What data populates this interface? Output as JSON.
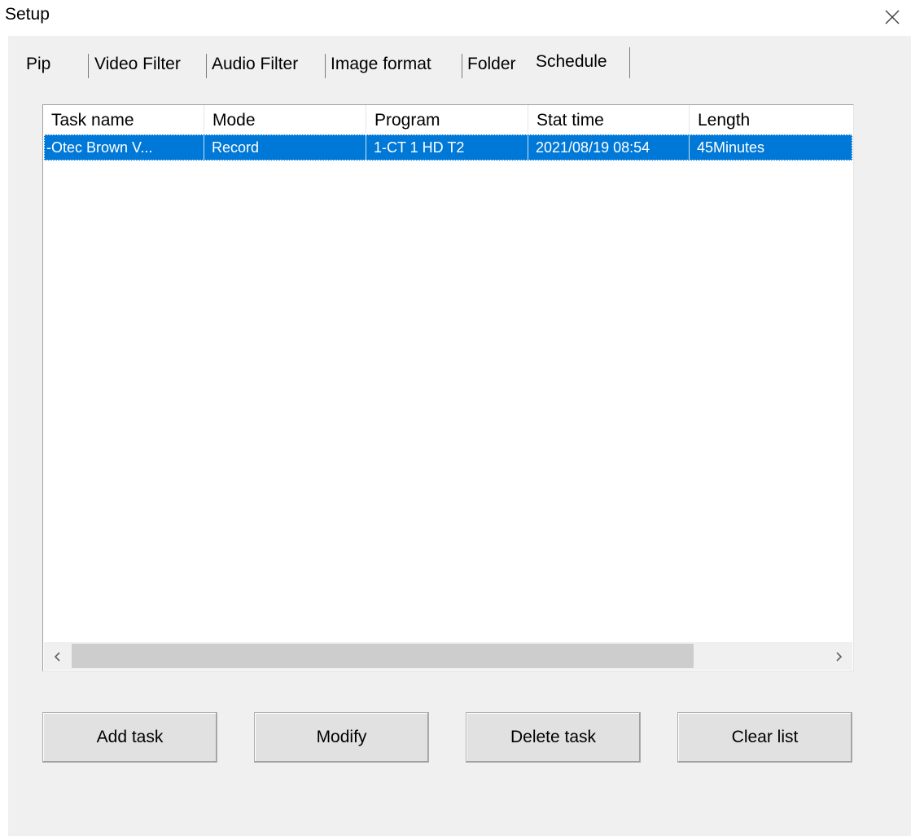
{
  "window": {
    "title": "Setup",
    "close_icon": "close-icon"
  },
  "tabs": [
    {
      "label": "Pip",
      "active": false
    },
    {
      "label": "Video Filter",
      "active": false
    },
    {
      "label": "Audio Filter",
      "active": false
    },
    {
      "label": "Image format",
      "active": false
    },
    {
      "label": "Folder",
      "active": false
    },
    {
      "label": "Schedule",
      "active": true
    }
  ],
  "schedule": {
    "columns": [
      "Task name",
      "Mode",
      "Program",
      "Stat time",
      "Length"
    ],
    "rows": [
      {
        "task_name": "-Otec Brown V...",
        "mode": "Record",
        "program": "1-CT 1 HD T2",
        "start_time": "2021/08/19 08:54",
        "length": "45Minutes",
        "selected": true
      }
    ],
    "scroll_left_icon": "chevron-left-icon",
    "scroll_right_icon": "chevron-right-icon"
  },
  "buttons": {
    "add_task": "Add task",
    "modify": "Modify",
    "delete_task": "Delete task",
    "clear_list": "Clear list"
  },
  "colors": {
    "selection": "#0078d7",
    "dialog_bg": "#f0f0f0"
  }
}
